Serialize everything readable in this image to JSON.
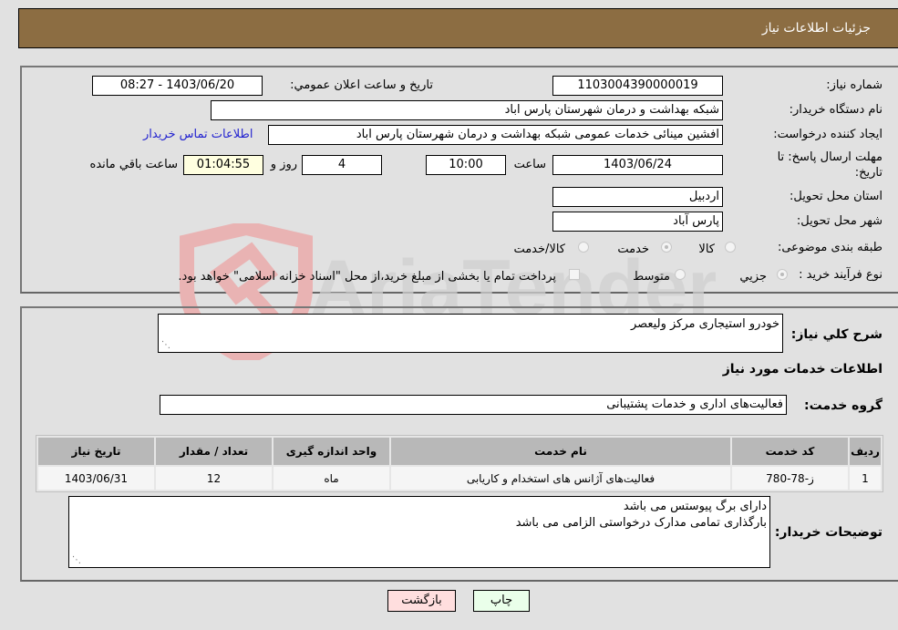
{
  "header": {
    "title": "جزئیات اطلاعات نیاز"
  },
  "details": {
    "need_number": {
      "label": "شماره نیاز:",
      "value": "1103004390000019"
    },
    "announce_datetime": {
      "label": "تاريخ و ساعت اعلان عمومي:",
      "value": "1403/06/20 - 08:27"
    },
    "buyer_org": {
      "label": "نام دستگاه خریدار:",
      "value": "شبکه بهداشت و درمان شهرستان پارس اباد"
    },
    "requester": {
      "label": "ایجاد کننده درخواست:",
      "value": "افشین مینائی خدمات عمومی شبکه بهداشت و درمان شهرستان پارس اباد"
    },
    "buyer_contact_link": "اطلاعات تماس خریدار",
    "deadline": {
      "label_line1": "مهلت ارسال پاسخ: تا",
      "label_line2": "تاریخ:",
      "date": "1403/06/24",
      "time_label": "ساعت",
      "time": "10:00",
      "days": "4",
      "days_label": "روز و",
      "remaining": "01:04:55",
      "remaining_label": "ساعت باقي مانده"
    },
    "province": {
      "label": "استان محل تحویل:",
      "value": "اردبیل"
    },
    "city": {
      "label": "شهر محل تحویل:",
      "value": "پارس آباد"
    },
    "category": {
      "label": "طبقه بندی موضوعی:",
      "options": [
        "کالا",
        "خدمت",
        "کالا/خدمت"
      ],
      "selected": "خدمت"
    },
    "purchase_type": {
      "label": "نوع فرآیند خرید :",
      "options": [
        "جزيي",
        "متوسط"
      ],
      "selected": "جزيي",
      "treasury_note": "پرداخت تمام یا بخشی از مبلغ خرید،از محل \"اسناد خزانه اسلامی\" خواهد بود."
    }
  },
  "watermark": {
    "text": "AriaTender.neT"
  },
  "services": {
    "description_label": "شرح کلي نیاز:",
    "description": "خودرو استیجاری مرکز ولیعصر",
    "section_title": "اطلاعات خدمات مورد نیاز",
    "group_label": "گروه خدمت:",
    "group_value": "فعالیت‌های اداری و خدمات پشتیبانی",
    "table": {
      "headers": [
        "ردیف",
        "کد خدمت",
        "نام خدمت",
        "واحد اندازه گیری",
        "تعداد / مقدار",
        "تاریخ نیاز"
      ],
      "rows": [
        [
          "1",
          "ز-78-780",
          "فعالیت‌های آژانس های استخدام و کاریابی",
          "ماه",
          "12",
          "1403/06/31"
        ]
      ]
    },
    "buyer_notes_label": "توضیحات خریدار:",
    "buyer_notes_line1": "دارای برگ پیوستس می باشد",
    "buyer_notes_line2": "بارگذاری تمامی مدارک درخواستی الزامی می باشد"
  },
  "buttons": {
    "print": "چاپ",
    "back": "بازگشت"
  },
  "colors": {
    "header_bg": "#8c6d42",
    "print_bg": "#eaffea",
    "back_bg": "#ffdede",
    "link": "#2323d0"
  }
}
